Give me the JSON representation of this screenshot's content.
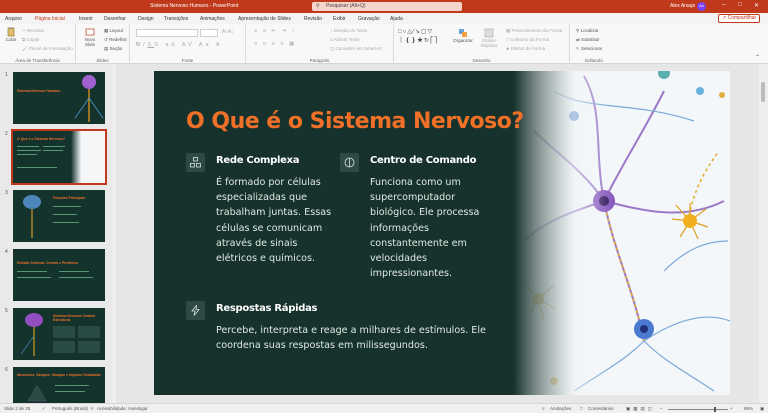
{
  "titlebar": {
    "title": "Sistema Nervoso Humano  -  PowerPoint",
    "search_placeholder": "Pesquisar (Alt+Q)",
    "user_name": "Alex Araujo",
    "user_initials": "AA"
  },
  "tabs": [
    "Arquivo",
    "Página Inicial",
    "Inserir",
    "Desenhar",
    "Design",
    "Transições",
    "Animações",
    "Apresentação de Slides",
    "Revisão",
    "Exibir",
    "Gravação",
    "Ajuda"
  ],
  "active_tab": "Página Inicial",
  "share_label": "Compartilhar",
  "ribbon": {
    "clipboard": {
      "paste": "Colar",
      "cut": "Recortar",
      "copy": "Copiar",
      "format_painter": "Pincel de Formatação",
      "label": "Área de Transferência"
    },
    "slides": {
      "new_slide": "Novo Slide",
      "layout": "Layout",
      "reset": "Redefinir",
      "section": "Seção",
      "label": "Slides"
    },
    "font": {
      "label": "Fonte"
    },
    "paragraph": {
      "text_direction": "Direção do Texto",
      "align_text": "Alinhar Texto",
      "smartart": "Converter em SmartArt",
      "label": "Parágrafo"
    },
    "drawing": {
      "arrange": "Organizar",
      "quick_styles": "Estilos Rápidos",
      "shape_fill": "Preenchimento da Forma",
      "shape_outline": "Contorno da Forma",
      "shape_effects": "Efeitos de Forma",
      "label": "Desenho"
    },
    "editing": {
      "find": "Localizar",
      "replace": "Substituir",
      "select": "Selecionar",
      "label": "Editando"
    }
  },
  "thumbnails": [
    {
      "num": "1",
      "title": "Sistema Nervoso Humano"
    },
    {
      "num": "2",
      "title": "O Que é o Sistema Nervoso?"
    },
    {
      "num": "3",
      "title": "Funções Principais"
    },
    {
      "num": "4",
      "title": "Divisão Sistema: Central e Periférico"
    },
    {
      "num": "5",
      "title": "Sistema Nervoso Central: Estruturas"
    },
    {
      "num": "6",
      "title": "Neurônios, Sinapse, Sinapse e Impulso Sinalizada"
    }
  ],
  "slide": {
    "title": "O Que é o Sistema Nervoso?",
    "features": [
      {
        "heading": "Rede Complexa",
        "icon": "network-icon",
        "lines": [
          "É formado por células",
          "especializadas que",
          "trabalham juntas. Essas",
          "células se comunicam",
          "através de sinais",
          "elétricos e químicos."
        ]
      },
      {
        "heading": "Centro de Comando",
        "icon": "brain-icon",
        "lines": [
          "Funciona como um",
          "supercomputador",
          "biológico. Ele processa",
          "informações",
          "constantemente em",
          "velocidades",
          "impressionantes."
        ]
      },
      {
        "heading": "Respostas Rápidas",
        "icon": "lightning-icon",
        "lines": [
          "Percebe, interpreta e reage a milhares de estímulos. Ele",
          "coordena suas respostas em milissegundos."
        ]
      }
    ],
    "colors": {
      "background": "#17322c",
      "title": "#f07028",
      "heading": "#ffffff",
      "body": "#dfe9e4"
    }
  },
  "status": {
    "slide_counter": "Slide 2 de 25",
    "language": "Português (Brasil)",
    "accessibility": "Acessibilidade: Investigar",
    "notes": "Anotações",
    "comments": "Comentários",
    "zoom": "86%"
  }
}
